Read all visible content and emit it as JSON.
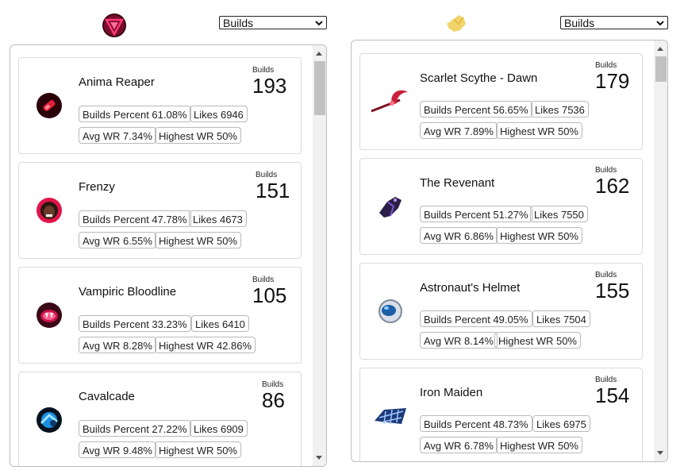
{
  "left": {
    "logo": "pink-triangle-logo-icon",
    "select": {
      "value": "Builds"
    },
    "cards": [
      {
        "name": "Anima Reaper",
        "builds_label": "Builds",
        "builds": "193",
        "icon": "red-vial-icon",
        "builds_percent": "Builds Percent 61.08%",
        "likes": "Likes 6946",
        "avg_wr": "Avg WR 7.34%",
        "highest_wr": "Highest WR 50%"
      },
      {
        "name": "Frenzy",
        "builds_label": "Builds",
        "builds": "151",
        "icon": "frenzy-face-icon",
        "builds_percent": "Builds Percent 47.78%",
        "likes": "Likes 4673",
        "avg_wr": "Avg WR 6.55%",
        "highest_wr": "Highest WR 50%"
      },
      {
        "name": "Vampiric Bloodline",
        "builds_label": "Builds",
        "builds": "105",
        "icon": "vampire-mouth-icon",
        "builds_percent": "Builds Percent 33.23%",
        "likes": "Likes 6410",
        "avg_wr": "Avg WR 8.28%",
        "highest_wr": "Highest WR 42.86%"
      },
      {
        "name": "Cavalcade",
        "builds_label": "Builds",
        "builds": "86",
        "icon": "cavalcade-blue-icon",
        "builds_percent": "Builds Percent 27.22%",
        "likes": "Likes 6909",
        "avg_wr": "Avg WR 9.48%",
        "highest_wr": "Highest WR 50%"
      }
    ]
  },
  "right": {
    "logo": "yellow-glove-logo-icon",
    "select": {
      "value": "Builds"
    },
    "cards": [
      {
        "name": "Scarlet Scythe - Dawn",
        "builds_label": "Builds",
        "builds": "179",
        "icon": "scarlet-scythe-icon",
        "builds_percent": "Builds Percent 56.65%",
        "likes": "Likes 7536",
        "avg_wr": "Avg WR 7.89%",
        "highest_wr": "Highest WR 50%"
      },
      {
        "name": "The Revenant",
        "builds_label": "Builds",
        "builds": "162",
        "icon": "revenant-icon",
        "builds_percent": "Builds Percent 51.27%",
        "likes": "Likes 7550",
        "avg_wr": "Avg WR 6.86%",
        "highest_wr": "Highest WR 50%"
      },
      {
        "name": "Astronaut's Helmet",
        "builds_label": "Builds",
        "builds": "155",
        "icon": "astronaut-helmet-icon",
        "builds_percent": "Builds Percent 49.05%",
        "likes": "Likes 7504",
        "avg_wr": "Avg WR 8.14%",
        "highest_wr": "Highest WR 50%"
      },
      {
        "name": "Iron Maiden",
        "builds_label": "Builds",
        "builds": "154",
        "icon": "iron-maiden-icon",
        "builds_percent": "Builds Percent 48.73%",
        "likes": "Likes 6975",
        "avg_wr": "Avg WR 6.78%",
        "highest_wr": "Highest WR 50%"
      }
    ]
  },
  "colors": {
    "accent_pink": "#c0144a",
    "accent_yellow": "#f1d36a",
    "scroll_thumb": "#c1c1c1"
  }
}
